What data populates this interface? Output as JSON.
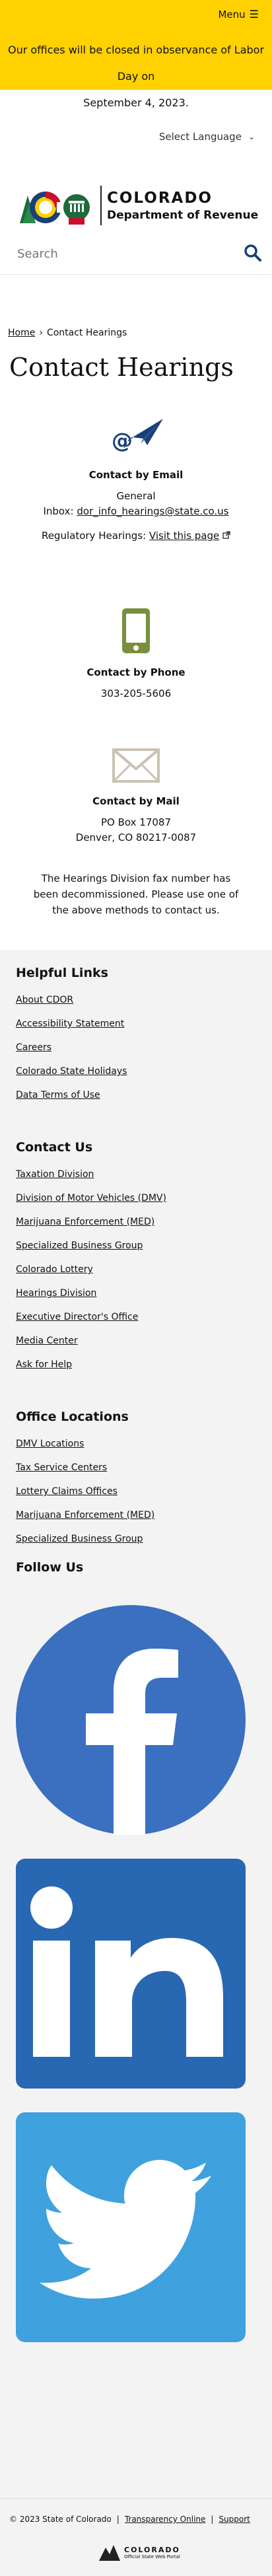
{
  "alert": {
    "menu_label": "Menu",
    "text_line1": "Our offices will be closed in observance of Labor Day on",
    "text_line2": "September 4, 2023."
  },
  "language": {
    "label": "Select Language"
  },
  "logo": {
    "line1": "COLORADO",
    "line2": "Department of Revenue",
    "seal_text": "CDOR"
  },
  "search": {
    "placeholder": "Search"
  },
  "breadcrumb": {
    "home": "Home",
    "separator": "›",
    "current": "Contact Hearings"
  },
  "page": {
    "title": "Contact Hearings"
  },
  "email": {
    "heading": "Contact by Email",
    "general": "General",
    "inbox_label": "Inbox:",
    "inbox_address": "dor_info_hearings@state.co.us",
    "regulatory_label": "Regulatory Hearings:",
    "regulatory_link": "Visit this page"
  },
  "phone": {
    "heading": "Contact by Phone",
    "number": "303-205-5606"
  },
  "mail": {
    "heading": "Contact by Mail",
    "line1": "PO Box 17087",
    "line2": "Denver, CO 80217-0087"
  },
  "fax_note": "The Hearings Division fax number has been decommissioned. Please use one of the above methods to contact us.",
  "footer": {
    "helpful": {
      "heading": "Helpful Links",
      "links": [
        "About CDOR",
        "Accessibility Statement",
        "Careers",
        "Colorado State Holidays",
        "Data Terms of Use"
      ]
    },
    "contact": {
      "heading": "Contact Us",
      "links": [
        "Taxation Division",
        "Division of Motor Vehicles (DMV)",
        "Marijuana Enforcement (MED)",
        "Specialized Business Group",
        "Colorado Lottery",
        "Hearings Division",
        "Executive Director's Office",
        "Media Center",
        "Ask for Help"
      ]
    },
    "offices": {
      "heading": "Office Locations",
      "links": [
        "DMV Locations",
        "Tax Service Centers",
        "Lottery Claims Offices",
        "Marijuana Enforcement (MED)",
        "Specialized Business Group"
      ]
    },
    "follow": {
      "heading": "Follow Us"
    },
    "social_colors": {
      "facebook": "#3b6fc0",
      "linkedin": "#2867b2",
      "twitter": "#3fa1dd"
    }
  },
  "legal": {
    "copyright": "© 2023 State of Colorado",
    "sep": "|",
    "transparency": "Transparency Online",
    "support": "Support",
    "portal_line1": "COLORADO",
    "portal_line2": "Official State Web Portal"
  },
  "colors": {
    "alert_bg": "#ffd100",
    "footer_bg": "#f3f3f3",
    "brand_navy": "#1b3f78"
  }
}
